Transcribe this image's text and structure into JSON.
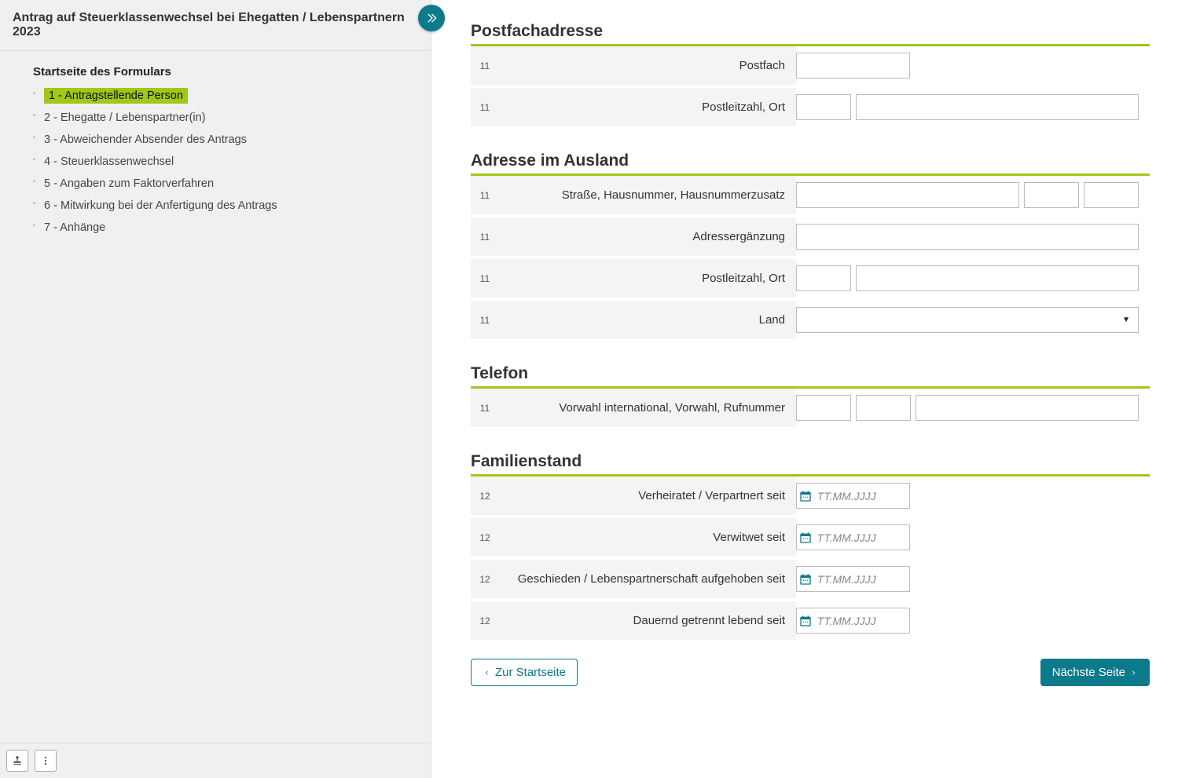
{
  "sidebar": {
    "title": "Antrag auf Steuerklassenwechsel bei Ehegatten / Lebenspartnern  2023",
    "nav_title": "Startseite des Formulars",
    "items": [
      {
        "label": "1 - Antragstellende Person",
        "active": true
      },
      {
        "label": "2 - Ehegatte / Lebenspartner(in)"
      },
      {
        "label": "3 - Abweichender Absender des Antrags"
      },
      {
        "label": "4 - Steuerklassenwechsel"
      },
      {
        "label": "5 - Angaben zum Faktorverfahren"
      },
      {
        "label": "6 - Mitwirkung bei der Anfertigung des Antrags"
      },
      {
        "label": "7 - Anhänge"
      }
    ]
  },
  "sections": {
    "postfach": {
      "title": "Postfachadresse",
      "rows": [
        {
          "ln": "11",
          "label": "Postfach"
        },
        {
          "ln": "11",
          "label": "Postleitzahl,  Ort"
        }
      ]
    },
    "ausland": {
      "title": "Adresse im Ausland",
      "rows": [
        {
          "ln": "11",
          "label": "Straße,  Hausnummer,  Hausnummerzusatz"
        },
        {
          "ln": "11",
          "label": "Adressergänzung"
        },
        {
          "ln": "11",
          "label": "Postleitzahl,  Ort"
        },
        {
          "ln": "11",
          "label": "Land"
        }
      ]
    },
    "telefon": {
      "title": "Telefon",
      "rows": [
        {
          "ln": "11",
          "label": "Vorwahl international,  Vorwahl,  Rufnummer"
        }
      ]
    },
    "familie": {
      "title": "Familienstand",
      "rows": [
        {
          "ln": "12",
          "label": "Verheiratet / Verpartnert seit"
        },
        {
          "ln": "12",
          "label": "Verwitwet seit"
        },
        {
          "ln": "12",
          "label": "Geschieden / Lebenspartnerschaft aufgehoben seit"
        },
        {
          "ln": "12",
          "label": "Dauernd getrennt lebend seit"
        }
      ]
    }
  },
  "date_placeholder": "TT.MM.JJJJ",
  "footer": {
    "back": "Zur Startseite",
    "next": "Nächste Seite"
  }
}
